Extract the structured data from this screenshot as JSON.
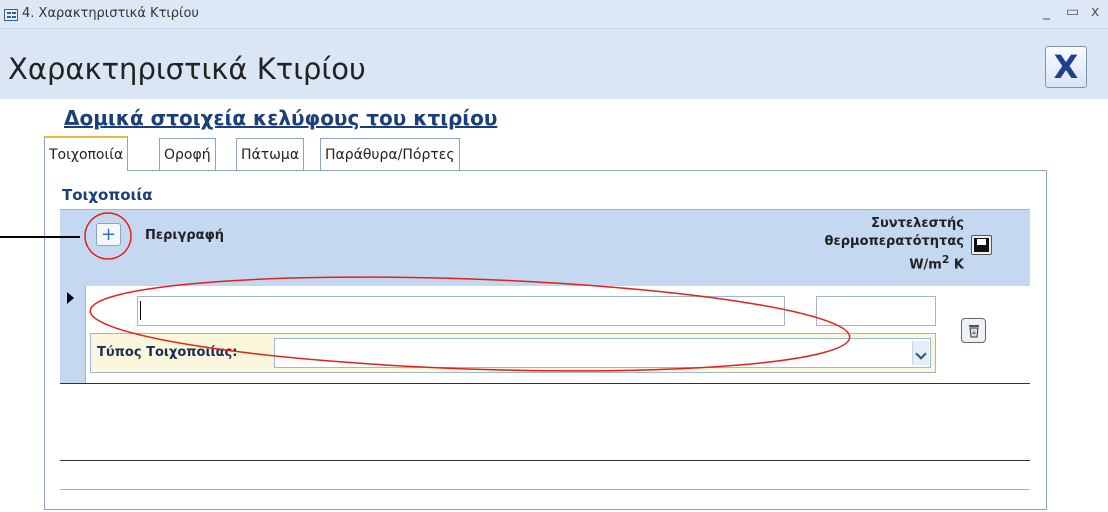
{
  "window": {
    "title": "4. Χαρακτηριστικά Κτιρίου",
    "minimize": "_",
    "maximize": "▭",
    "close": "x"
  },
  "form": {
    "title": "Χαρακτηριστικά Κτιρίου",
    "close_label": "X"
  },
  "section_title": "Δομικά στοιχεία κελύφους του κτιρίου",
  "tabs": [
    {
      "label": "Τοιχοποιία",
      "active": true
    },
    {
      "label": "Οροφή",
      "active": false
    },
    {
      "label": "Πάτωμα",
      "active": false
    },
    {
      "label": "Παράθυρα/Πόρτες",
      "active": false
    }
  ],
  "subform": {
    "title": "Τοιχοποιία",
    "add_label": "+",
    "description_header": "Περιγραφή",
    "coefficient_header_line1": "Συντελεστής",
    "coefficient_header_line2": "θερμοπερατότητας",
    "coefficient_header_unit": "W/m",
    "coefficient_header_exp": "2",
    "coefficient_header_unit2": " K",
    "type_label": "Τύπος Τοιχοποιίας:",
    "description_value": "",
    "coefficient_value": "",
    "type_value": ""
  },
  "annotations": {
    "color": "#e32119"
  },
  "colors": {
    "header_bg": "#dbe6f5",
    "grid_header_bg": "#c5d8f1",
    "title_blue": "#1a3f7a",
    "tab_accent": "#f0b63c"
  }
}
